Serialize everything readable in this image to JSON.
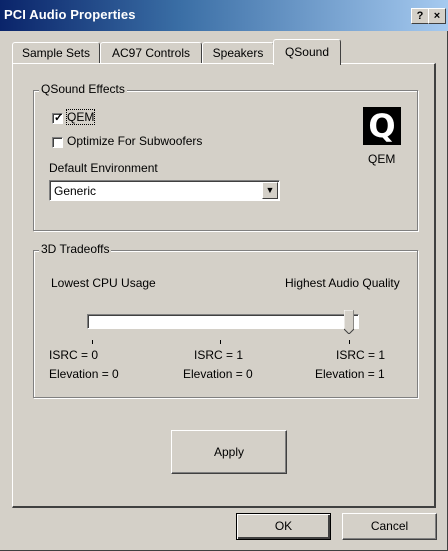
{
  "window": {
    "title": "PCI Audio Properties",
    "help_button": "?",
    "close_button": "×"
  },
  "tabs": [
    {
      "label": "Sample Sets",
      "active": false
    },
    {
      "label": "AC97 Controls",
      "active": false
    },
    {
      "label": "Speakers",
      "active": false
    },
    {
      "label": "QSound",
      "active": true
    }
  ],
  "qsound_effects": {
    "group_label": "QSound Effects",
    "qem": {
      "label": "QEM",
      "checked": true
    },
    "subwoofer": {
      "label": "Optimize For Subwoofers",
      "checked": false
    },
    "logo_glyph": "Q",
    "logo_caption": "QEM",
    "default_env_label": "Default Environment",
    "default_env_value": "Generic"
  },
  "tradeoffs": {
    "group_label": "3D Tradeoffs",
    "left_label": "Lowest CPU Usage",
    "right_label": "Highest Audio Quality",
    "slider_position": 1.0,
    "ticks": [
      {
        "isrc": "ISRC = 0",
        "elevation": "Elevation = 0"
      },
      {
        "isrc": "ISRC = 1",
        "elevation": "Elevation = 0"
      },
      {
        "isrc": "ISRC = 1",
        "elevation": "Elevation = 1"
      }
    ]
  },
  "buttons": {
    "apply": "Apply",
    "ok": "OK",
    "cancel": "Cancel"
  },
  "colors": {
    "title_start": "#0a246a",
    "title_end": "#a6caf0",
    "face": "#d4d0c8"
  }
}
